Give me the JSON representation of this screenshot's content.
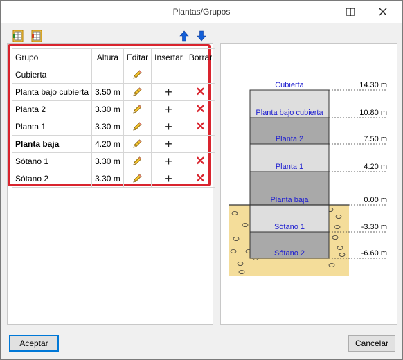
{
  "window": {
    "title": "Plantas/Grupos"
  },
  "table": {
    "headers": {
      "grupo": "Grupo",
      "altura": "Altura",
      "editar": "Editar",
      "insertar": "Insertar",
      "borrar": "Borrar"
    },
    "rows": [
      {
        "grupo": "Cubierta",
        "altura": "",
        "bold": false,
        "insertar": false,
        "borrar": false
      },
      {
        "grupo": "Planta bajo cubierta",
        "altura": "3.50 m",
        "bold": false,
        "insertar": true,
        "borrar": true
      },
      {
        "grupo": "Planta 2",
        "altura": "3.30 m",
        "bold": false,
        "insertar": true,
        "borrar": true
      },
      {
        "grupo": "Planta 1",
        "altura": "3.30 m",
        "bold": false,
        "insertar": true,
        "borrar": true
      },
      {
        "grupo": "Planta baja",
        "altura": "4.20 m",
        "bold": true,
        "insertar": true,
        "borrar": false
      },
      {
        "grupo": "Sótano 1",
        "altura": "3.30 m",
        "bold": false,
        "insertar": true,
        "borrar": true
      },
      {
        "grupo": "Sótano 2",
        "altura": "3.30 m",
        "bold": false,
        "insertar": true,
        "borrar": true
      }
    ]
  },
  "diagram": {
    "levels": [
      {
        "name": "Cubierta",
        "elevation": "14.30 m"
      },
      {
        "name": "Planta bajo cubierta",
        "elevation": "10.80 m"
      },
      {
        "name": "Planta 2",
        "elevation": "7.50 m"
      },
      {
        "name": "Planta 1",
        "elevation": "4.20 m"
      },
      {
        "name": "Planta baja",
        "elevation": "0.00 m"
      },
      {
        "name": "Sótano 1",
        "elevation": "-3.30 m"
      },
      {
        "name": "Sótano 2",
        "elevation": "-6.60 m"
      }
    ],
    "colors": {
      "label": "#1f1fd0",
      "dark": "#a9a9a9",
      "light": "#dedede",
      "soil": "#f4dd9a"
    }
  },
  "buttons": {
    "accept": "Aceptar",
    "cancel": "Cancelar"
  },
  "colors": {
    "highlight": "#d9242e",
    "arrow": "#1460d8"
  }
}
